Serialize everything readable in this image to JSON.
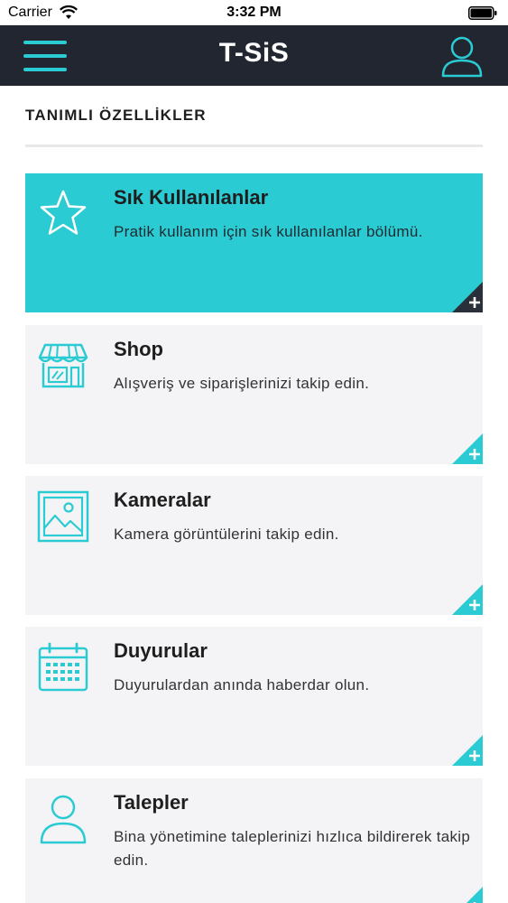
{
  "status_bar": {
    "carrier": "Carrier",
    "time": "3:32 PM",
    "icons": [
      "wifi-icon",
      "battery-icon"
    ]
  },
  "nav": {
    "title": "T-SiS",
    "left_icon": "menu-icon",
    "right_icon": "profile-icon",
    "background": "#222631",
    "accent": "#2bcbd3"
  },
  "section": {
    "title": "TANIMLI ÖZELLİKLER"
  },
  "cards": [
    {
      "title": "Sık Kullanılanlar",
      "description": "Pratik kullanım için sık kullanılanlar bölümü.",
      "icon": "star-icon",
      "active": true
    },
    {
      "title": "Shop",
      "description": "Alışveriş ve siparişlerinizi takip edin.",
      "icon": "shop-icon",
      "active": false
    },
    {
      "title": "Kameralar",
      "description": "Kamera görüntülerini takip edin.",
      "icon": "image-icon",
      "active": false
    },
    {
      "title": "Duyurular",
      "description": "Duyurulardan anında haberdar olun.",
      "icon": "calendar-icon",
      "active": false
    },
    {
      "title": "Talepler",
      "description": "Bina yönetimine taleplerinizi hızlıca bildirerek takip edin.",
      "icon": "user-icon",
      "active": false
    }
  ],
  "colors": {
    "accent": "#2bcbd3",
    "card_background": "#f4f4f6",
    "corner_active": "#2a3039"
  }
}
